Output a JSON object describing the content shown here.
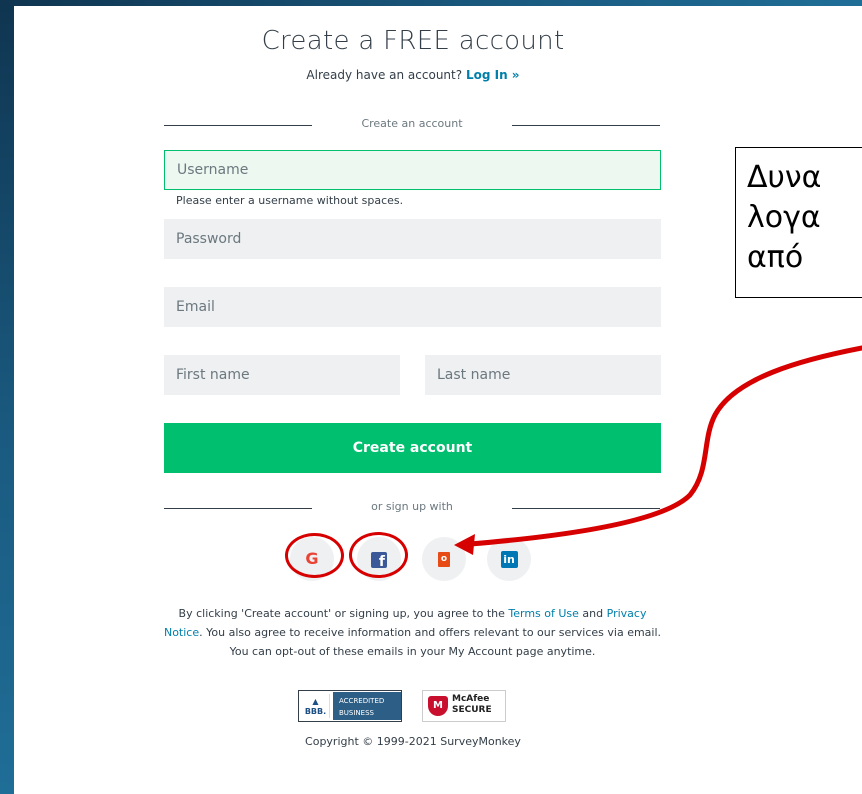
{
  "page": {
    "title": "Create a FREE account",
    "subtitle_prefix": "Already have an account?",
    "login_link": "Log In »",
    "section_label": "Create an account",
    "or_label": "or sign up with",
    "copyright": "Copyright © 1999-2021 SurveyMonkey"
  },
  "form": {
    "username_placeholder": "Username",
    "username_hint": "Please enter a username without spaces.",
    "password_placeholder": "Password",
    "email_placeholder": "Email",
    "first_name_placeholder": "First name",
    "last_name_placeholder": "Last name",
    "submit_label": "Create account"
  },
  "social": [
    {
      "icon": "google-icon",
      "glyph": "G",
      "color": "#ea4335"
    },
    {
      "icon": "facebook-icon",
      "glyph": "f",
      "color": "#3b5998"
    },
    {
      "icon": "office-icon",
      "glyph": "o",
      "color": "#e74c16"
    },
    {
      "icon": "linkedin-icon",
      "glyph": "in",
      "color": "#0077b5"
    }
  ],
  "terms": {
    "part1": "By clicking 'Create account' or signing up, you agree to the ",
    "terms_link": "Terms of Use",
    "part2": " and ",
    "privacy_link": "Privacy Notice",
    "part3": ". You also agree to receive information and offers relevant to our services via email. You can opt-out of these emails in your My Account page anytime."
  },
  "badges": {
    "bbb_line1": "ACCREDITED",
    "bbb_line2": "BUSINESS",
    "bbb_abbr": "BBB.",
    "mcafee_line1": "McAfee",
    "mcafee_line2": "SECURE"
  },
  "annotation": {
    "line1": "Δυνα",
    "line2": "λογα",
    "line3": "από"
  },
  "colors": {
    "accent_green": "#00bf6f",
    "link_blue": "#007faa",
    "annotation_red": "#d60000"
  }
}
